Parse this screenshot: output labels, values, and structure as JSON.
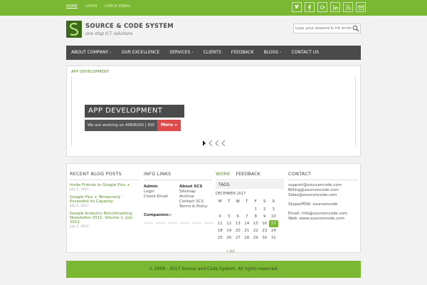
{
  "topbar": {
    "links": [
      "HOME",
      "LOGIN",
      "CHECK EMAIL"
    ],
    "social_icons": [
      "twitter-icon",
      "facebook-icon",
      "google-plus-icon",
      "linkedin-icon",
      "rss-icon",
      "email-icon"
    ]
  },
  "brand": {
    "name": "SOURCE & CODE SYSTEM",
    "tagline": "one stop ICT solutions",
    "accent": "#7ab833",
    "dark": "#4a4a4a"
  },
  "search": {
    "placeholder": "type your keword & hit enter"
  },
  "nav": {
    "items": [
      {
        "label": "ABOUT COMPANY",
        "dropdown": true
      },
      {
        "label": "OUR EXCELLENCE",
        "dropdown": false
      },
      {
        "label": "SERVICES",
        "dropdown": true
      },
      {
        "label": "CLIENTS",
        "dropdown": false
      },
      {
        "label": "FEEDBACK",
        "dropdown": false
      },
      {
        "label": "BLOGS",
        "dropdown": true
      },
      {
        "label": "CONTACT US",
        "dropdown": false
      }
    ]
  },
  "slider": {
    "crumb": "APP DEVELOPMENT",
    "title": "APP DEVELOPMENT",
    "text": "We are working on ANDROID | IOS",
    "more": "More »"
  },
  "blog": {
    "title": "RECENT BLOG POSTS",
    "posts": [
      {
        "title": "Invite Friends to Google Plus +",
        "date": "July 5, 2011"
      },
      {
        "title": "Google Plus + Temporarly Exceeded its Capacity",
        "date": "July 5, 2011"
      },
      {
        "title": "Google Analytics Benchmarking Newsletter 2011: Volume 1, July 2011",
        "date": "July 2, 2011"
      }
    ]
  },
  "info": {
    "title": "INFO LINKS",
    "col1": {
      "heading": "Admin",
      "links": [
        "Login",
        "Check Email"
      ]
    },
    "col2": {
      "heading": "About SCS",
      "links": [
        "Sitemap",
        "Archive",
        "Contact SCS",
        "Terms & Policy"
      ]
    },
    "companion": "Companion:-"
  },
  "calendar": {
    "tabs": [
      "WORK",
      "FEEDBACK"
    ],
    "active_tab": "WORK",
    "tags_label": "TAGS",
    "month": "DECEMBER 2017",
    "weekdays": [
      "M",
      "T",
      "W",
      "T",
      "F",
      "S",
      "S"
    ],
    "weeks": [
      [
        "",
        "",
        "",
        "",
        "1",
        "2",
        "3"
      ],
      [
        "4",
        "5",
        "6",
        "7",
        "8",
        "9",
        "10"
      ],
      [
        "11",
        "12",
        "13",
        "14",
        "15",
        "16",
        "17"
      ],
      [
        "18",
        "19",
        "20",
        "21",
        "22",
        "23",
        "24"
      ],
      [
        "25",
        "26",
        "27",
        "28",
        "29",
        "30",
        "31"
      ]
    ],
    "today": "17",
    "prev": "« Jul"
  },
  "contact": {
    "title": "CONTACT",
    "lines": [
      "support@sourcencode.com",
      "Billing@sourcencode.com",
      "Sales@sourcencode.com"
    ],
    "skype": "Skype/MSN: sourcencode",
    "email": "Email: info@sourcencode.com",
    "web": "Web: www.sourcencode.com"
  },
  "footer": {
    "copyright": "© 2008 - 2017 Source and Code System. All rights reserved."
  }
}
